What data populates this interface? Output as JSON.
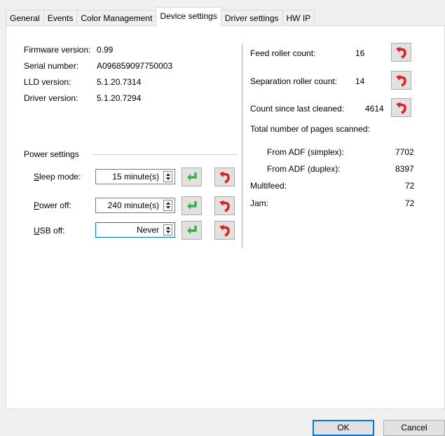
{
  "tabs": [
    "General",
    "Events",
    "Color Management",
    "Device settings",
    "Driver settings",
    "HW IP"
  ],
  "info": {
    "firmware_label": "Firmware version:",
    "firmware_value": "0.99",
    "serial_label": "Serial number:",
    "serial_value": "A096859097750003",
    "lld_label": "LLD version:",
    "lld_value": "5.1.20.7314",
    "driver_label": "Driver version:",
    "driver_value": "5.1.20.7294"
  },
  "power": {
    "group_label": "Power settings",
    "sleep": {
      "label_first": "S",
      "label_rest": "leep mode:",
      "value": "15 minute(s)"
    },
    "poweroff": {
      "label_first": "P",
      "label_rest": "ower off:",
      "value": "240 minute(s)"
    },
    "usboff": {
      "label_first": "U",
      "label_rest": "SB off:",
      "value": "Never"
    }
  },
  "counters": {
    "feed_label": "Feed roller count:",
    "feed_value": "16",
    "separation_label": "Separation roller count:",
    "separation_value": "14",
    "cleaned_label": "Count since last cleaned:",
    "cleaned_value": "4614",
    "total_label": "Total number of pages scanned:",
    "simplex_label": "From ADF (simplex):",
    "simplex_value": "7702",
    "duplex_label": "From ADF (duplex):",
    "duplex_value": "8397",
    "multifeed_label": "Multifeed:",
    "multifeed_value": "72",
    "jam_label": "Jam:",
    "jam_value": "72"
  },
  "footer": {
    "ok": "OK",
    "cancel": "Cancel"
  },
  "colors": {
    "accent": "#0078d7",
    "reset_red": "#e02020",
    "apply_green": "#3cb043"
  }
}
